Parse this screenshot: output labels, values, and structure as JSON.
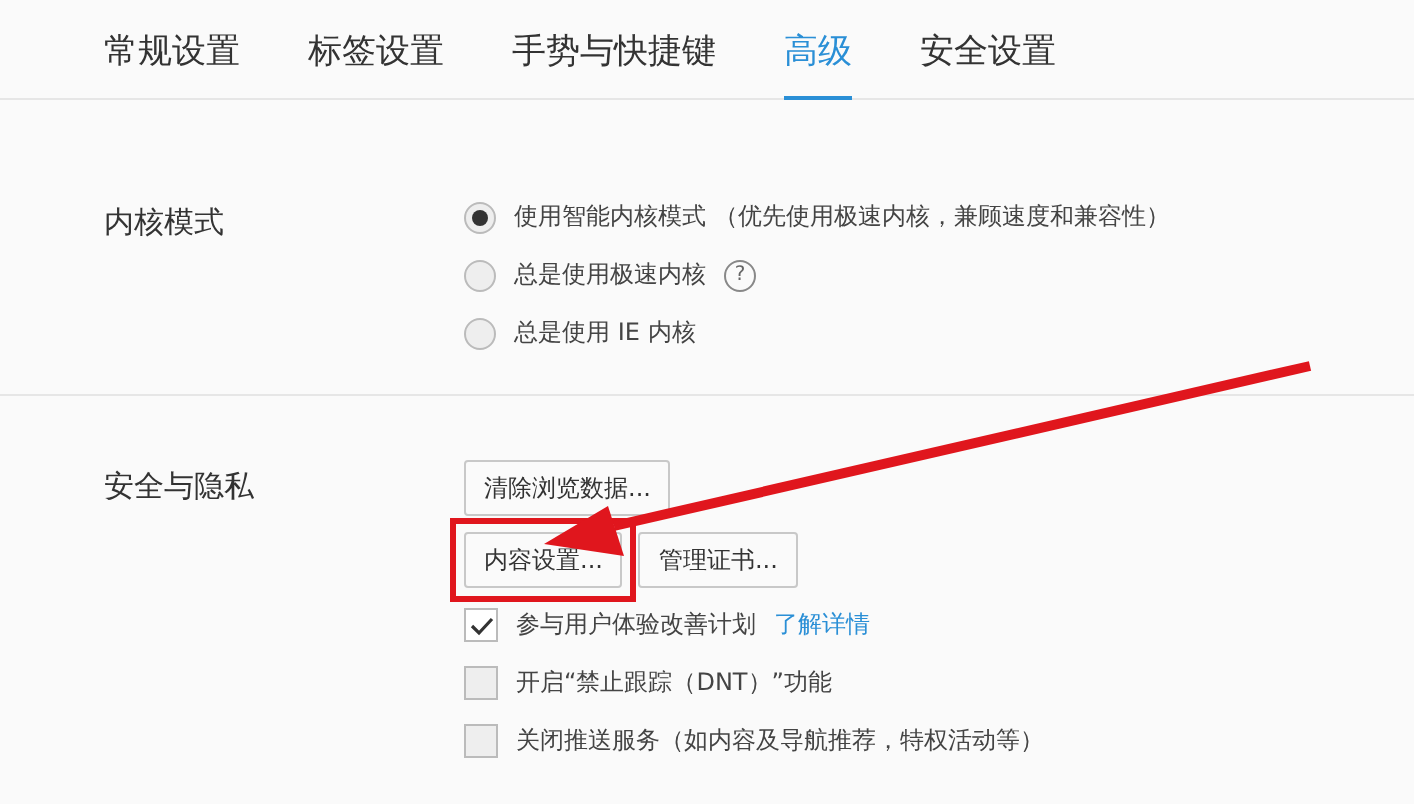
{
  "tabs": [
    {
      "label": "常规设置",
      "selected": false
    },
    {
      "label": "标签设置",
      "selected": false
    },
    {
      "label": "手势与快捷键",
      "selected": false
    },
    {
      "label": "高级",
      "selected": true
    },
    {
      "label": "安全设置",
      "selected": false
    }
  ],
  "sections": [
    {
      "title": "内核模式",
      "items": [
        {
          "kind": "radio",
          "label": "使用智能内核模式 （优先使用极速内核，兼顾速度和兼容性）",
          "selected": true
        },
        {
          "kind": "radio",
          "label": "总是使用极速内核",
          "selected": false,
          "help": "?"
        },
        {
          "kind": "radio",
          "label": "总是使用 IE 内核",
          "selected": false
        }
      ]
    },
    {
      "title": "安全与隐私",
      "items": [
        {
          "kind": "buttons",
          "buttons": [
            {
              "label": "清除浏览数据...",
              "highlighted": false
            }
          ]
        },
        {
          "kind": "buttons",
          "buttons": [
            {
              "label": "内容设置...",
              "highlighted": true
            },
            {
              "label": "管理证书...",
              "highlighted": false
            }
          ]
        },
        {
          "kind": "checkbox",
          "label": "参与用户体验改善计划",
          "checked": true,
          "link": "了解详情"
        },
        {
          "kind": "checkbox",
          "label": "开启“禁止跟踪（DNT）”功能",
          "checked": false
        },
        {
          "kind": "checkbox",
          "label": "关闭推送服务（如内容及导航推荐，特权活动等）",
          "checked": false
        }
      ]
    }
  ]
}
